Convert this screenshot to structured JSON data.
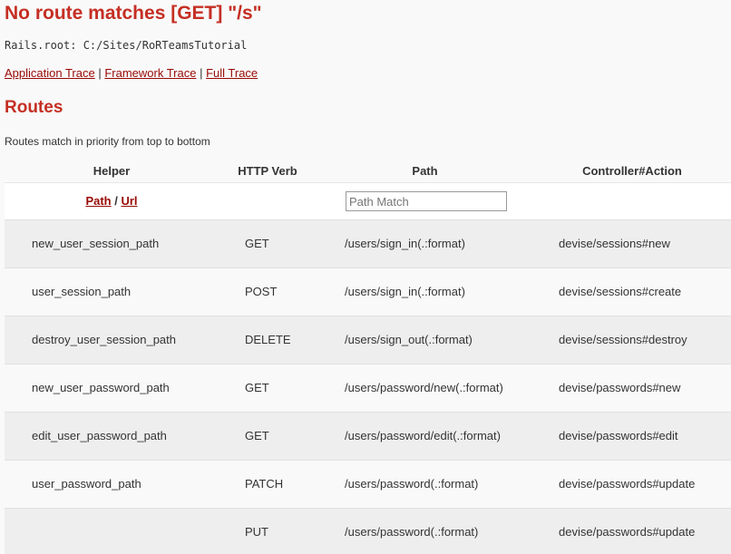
{
  "error": {
    "title": "No route matches [GET] \"/s\"",
    "rails_root": "Rails.root: C:/Sites/RoRTeamsTutorial"
  },
  "trace_links": {
    "application": "Application Trace",
    "separator1": " | ",
    "framework": "Framework Trace",
    "separator2": " | ",
    "full": "Full Trace"
  },
  "routes": {
    "heading": "Routes",
    "description": "Routes match in priority from top to bottom",
    "columns": {
      "helper": "Helper",
      "verb": "HTTP Verb",
      "path": "Path",
      "controller": "Controller#Action"
    },
    "helper_toggle": {
      "path": "Path",
      "separator": " / ",
      "url": "Url"
    },
    "search": {
      "placeholder": "Path Match",
      "value": ""
    },
    "rows": [
      {
        "helper": "new_user_session_path",
        "verb": "GET",
        "path": "/users/sign_in(.:format)",
        "controller": "devise/sessions#new"
      },
      {
        "helper": "user_session_path",
        "verb": "POST",
        "path": "/users/sign_in(.:format)",
        "controller": "devise/sessions#create"
      },
      {
        "helper": "destroy_user_session_path",
        "verb": "DELETE",
        "path": "/users/sign_out(.:format)",
        "controller": "devise/sessions#destroy"
      },
      {
        "helper": "new_user_password_path",
        "verb": "GET",
        "path": "/users/password/new(.:format)",
        "controller": "devise/passwords#new"
      },
      {
        "helper": "edit_user_password_path",
        "verb": "GET",
        "path": "/users/password/edit(.:format)",
        "controller": "devise/passwords#edit"
      },
      {
        "helper": "user_password_path",
        "verb": "PATCH",
        "path": "/users/password(.:format)",
        "controller": "devise/passwords#update"
      },
      {
        "helper": "",
        "verb": "PUT",
        "path": "/users/password(.:format)",
        "controller": "devise/passwords#update"
      }
    ]
  },
  "colors": {
    "heading_red": "#c52f24",
    "link_red": "#980905",
    "row_shaded": "#eeeeee",
    "background": "#f9f9f9"
  }
}
